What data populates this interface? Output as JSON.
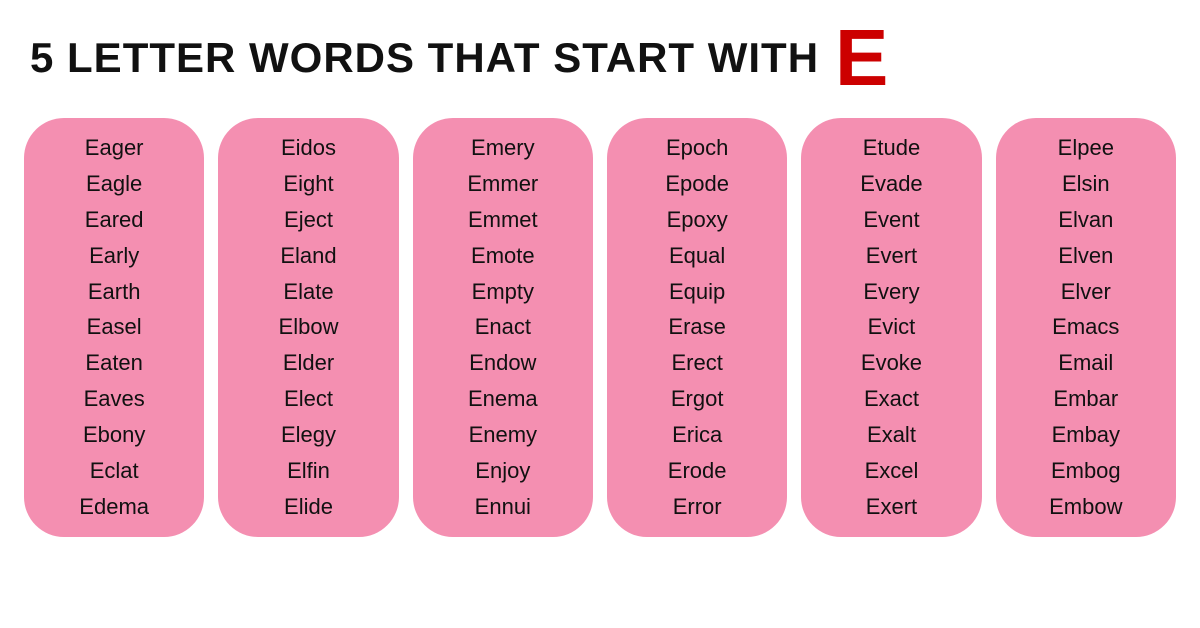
{
  "header": {
    "title": "5 LETTER WORDS THAT START WITH",
    "letter": "E"
  },
  "columns": [
    {
      "id": "col1",
      "words": [
        "Eager",
        "Eagle",
        "Eared",
        "Early",
        "Earth",
        "Easel",
        "Eaten",
        "Eaves",
        "Ebony",
        "Eclat",
        "Edema"
      ]
    },
    {
      "id": "col2",
      "words": [
        "Eidos",
        "Eight",
        "Eject",
        "Eland",
        "Elate",
        "Elbow",
        "Elder",
        "Elect",
        "Elegy",
        "Elfin",
        "Elide"
      ]
    },
    {
      "id": "col3",
      "words": [
        "Emery",
        "Emmer",
        "Emmet",
        "Emote",
        "Empty",
        "Enact",
        "Endow",
        "Enema",
        "Enemy",
        "Enjoy",
        "Ennui"
      ]
    },
    {
      "id": "col4",
      "words": [
        "Epoch",
        "Epode",
        "Epoxy",
        "Equal",
        "Equip",
        "Erase",
        "Erect",
        "Ergot",
        "Erica",
        "Erode",
        "Error"
      ]
    },
    {
      "id": "col5",
      "words": [
        "Etude",
        "Evade",
        "Event",
        "Evert",
        "Every",
        "Evict",
        "Evoke",
        "Exact",
        "Exalt",
        "Excel",
        "Exert"
      ]
    },
    {
      "id": "col6",
      "words": [
        "Elpee",
        "Elsin",
        "Elvan",
        "Elven",
        "Elver",
        "Emacs",
        "Email",
        "Embar",
        "Embay",
        "Embog",
        "Embow"
      ]
    }
  ]
}
